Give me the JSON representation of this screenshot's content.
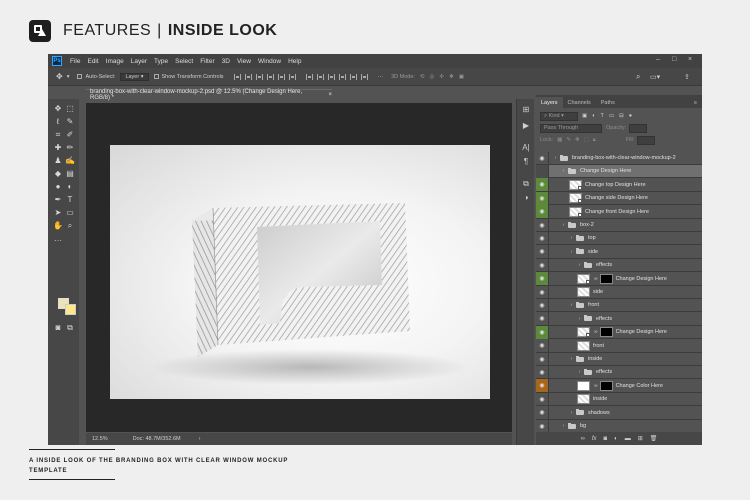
{
  "header": {
    "title_a": "FEATURES",
    "separator": "|",
    "title_b": "INSIDE LOOK"
  },
  "app": {
    "logo": "Ps",
    "menu": [
      "File",
      "Edit",
      "Image",
      "Layer",
      "Type",
      "Select",
      "Filter",
      "3D",
      "View",
      "Window",
      "Help"
    ],
    "window_controls": [
      "–",
      "□",
      "×"
    ]
  },
  "options_bar": {
    "auto_select": "Auto-Select:",
    "auto_select_value": "Layer",
    "show_transform": "Show Transform Controls",
    "mode_3d": "3D Mode:"
  },
  "document": {
    "tab_title": "branding-box-with-clear-window-mockup-2.psd @ 12.5% (Change Design Here, RGB/8) *",
    "close": "×",
    "zoom": "12.5%",
    "doc_info": "Doc: 48.7M/352.6M"
  },
  "panel": {
    "tabs": [
      "Layers",
      "Channels",
      "Paths"
    ],
    "filter_kind": "Kind",
    "blend_mode": "Pass Through",
    "opacity_label": "Opacity:",
    "lock_label": "Lock:",
    "fill_label": "Fill:",
    "layers": [
      {
        "name": "branding-box-with-clear-window-mockup-2",
        "type": "group",
        "level": 0,
        "vis": "normal"
      },
      {
        "name": "Change Design Here",
        "type": "group",
        "level": 1,
        "vis": "dark",
        "selected": true
      },
      {
        "name": "Change top Design Here",
        "type": "smart",
        "level": 2,
        "vis": "green"
      },
      {
        "name": "Change side Design Here",
        "type": "smart",
        "level": 2,
        "vis": "green"
      },
      {
        "name": "Change front Design Here",
        "type": "smart",
        "level": 2,
        "vis": "green"
      },
      {
        "name": "box-2",
        "type": "group",
        "level": 1,
        "vis": "normal"
      },
      {
        "name": "top",
        "type": "group",
        "level": 2,
        "vis": "normal"
      },
      {
        "name": "side",
        "type": "group",
        "level": 2,
        "vis": "normal"
      },
      {
        "name": "effects",
        "type": "group",
        "level": 3,
        "vis": "normal"
      },
      {
        "name": "Change Design Here",
        "type": "smartmask",
        "level": 3,
        "vis": "green"
      },
      {
        "name": "side",
        "type": "layer",
        "level": 3,
        "vis": "normal"
      },
      {
        "name": "front",
        "type": "group",
        "level": 2,
        "vis": "normal"
      },
      {
        "name": "effects",
        "type": "group",
        "level": 3,
        "vis": "normal"
      },
      {
        "name": "Change Design Here",
        "type": "smartmask",
        "level": 3,
        "vis": "green"
      },
      {
        "name": "front",
        "type": "layer",
        "level": 3,
        "vis": "normal"
      },
      {
        "name": "inside",
        "type": "group",
        "level": 2,
        "vis": "normal"
      },
      {
        "name": "effects",
        "type": "group",
        "level": 3,
        "vis": "normal"
      },
      {
        "name": "Change Color Here",
        "type": "fillmask",
        "level": 3,
        "vis": "orange"
      },
      {
        "name": "inside",
        "type": "layer",
        "level": 3,
        "vis": "normal"
      },
      {
        "name": "shadows",
        "type": "group",
        "level": 2,
        "vis": "normal"
      },
      {
        "name": "bg",
        "type": "group",
        "level": 1,
        "vis": "normal"
      }
    ],
    "footer_icons": [
      "link-icon",
      "fx-icon",
      "mask-icon",
      "adjustment-icon",
      "folder-icon",
      "new-layer-icon",
      "trash-icon"
    ]
  },
  "caption": {
    "text": "A INSIDE LOOK OF THE BRANDING BOX WITH CLEAR WINDOW MOCKUP TEMPLATE"
  }
}
